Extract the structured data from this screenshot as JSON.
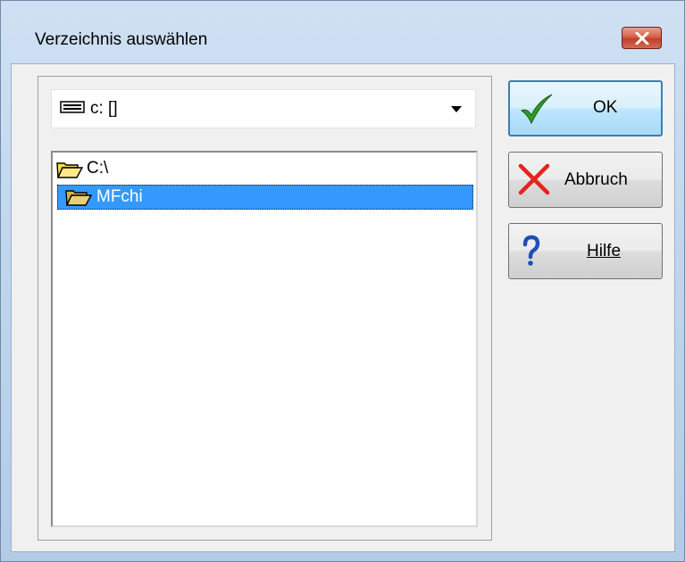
{
  "window": {
    "title": "Verzeichnis auswählen"
  },
  "drive_select": {
    "value": "c: []"
  },
  "tree": {
    "root_label": "C:\\",
    "selected_label": "MFchi",
    "selection_color": "#3399ff"
  },
  "buttons": {
    "ok_label": "OK",
    "cancel_label": "Abbruch",
    "help_label": "Hilfe"
  },
  "icons": {
    "close": "close-icon",
    "drive": "drive-icon",
    "folder": "folder-open-icon",
    "ok": "checkmark-icon",
    "cancel": "red-x-icon",
    "help": "question-mark-icon",
    "dropdown": "dropdown-arrow-icon"
  }
}
